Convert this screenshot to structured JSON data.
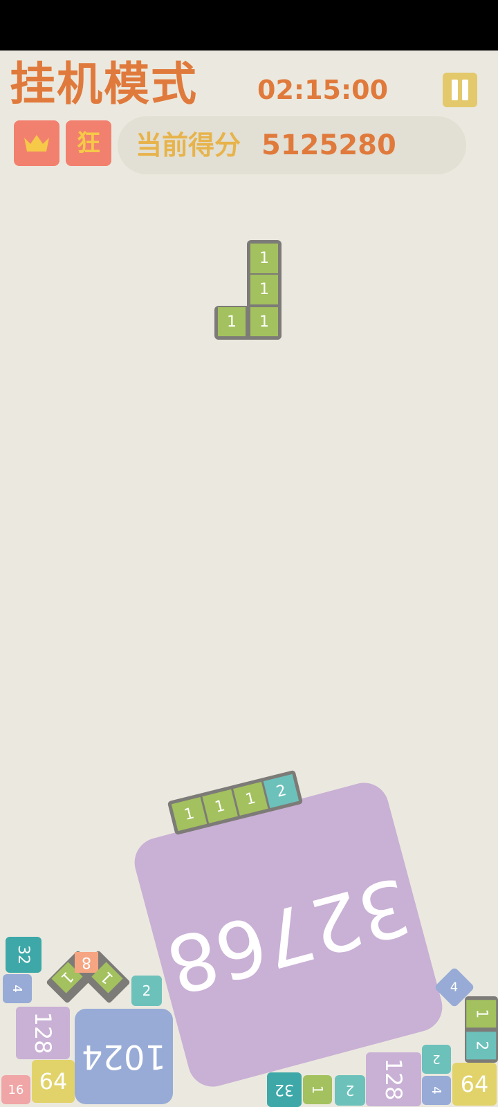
{
  "header": {
    "title": "挂机模式",
    "timer": "02:15:00",
    "badge_kuang": "狂",
    "score_label": "当前得分",
    "score_value": "5125280"
  },
  "icons": {
    "pause": "pause-icon",
    "crown": "crown-icon"
  },
  "colors": {
    "background": "#ebe9df",
    "title": "#e07a3c",
    "score_label": "#e7b34a",
    "badge": "#f2806e",
    "pause": "#e3c96c"
  },
  "falling_piece": {
    "cells": [
      "1",
      "1",
      "1",
      "1"
    ]
  },
  "board": {
    "big_tile": "32768",
    "bar_piece": [
      "1",
      "1",
      "1",
      "2"
    ],
    "v_piece": [
      "1",
      "8",
      "1"
    ],
    "right_piece": [
      "1",
      "2"
    ],
    "tiles": {
      "t32_left": "32",
      "t4_left": "4",
      "t2_left": "2",
      "t128_left": "128",
      "t1024": "1024",
      "t16": "16",
      "t64_left": "64",
      "t4_right_diamond": "4",
      "t32_bottom": "32",
      "t1_bottom": "1",
      "t2_bottom": "2",
      "t128_right": "128",
      "t2_right": "2",
      "t4_right": "4",
      "t64_right": "64"
    }
  }
}
